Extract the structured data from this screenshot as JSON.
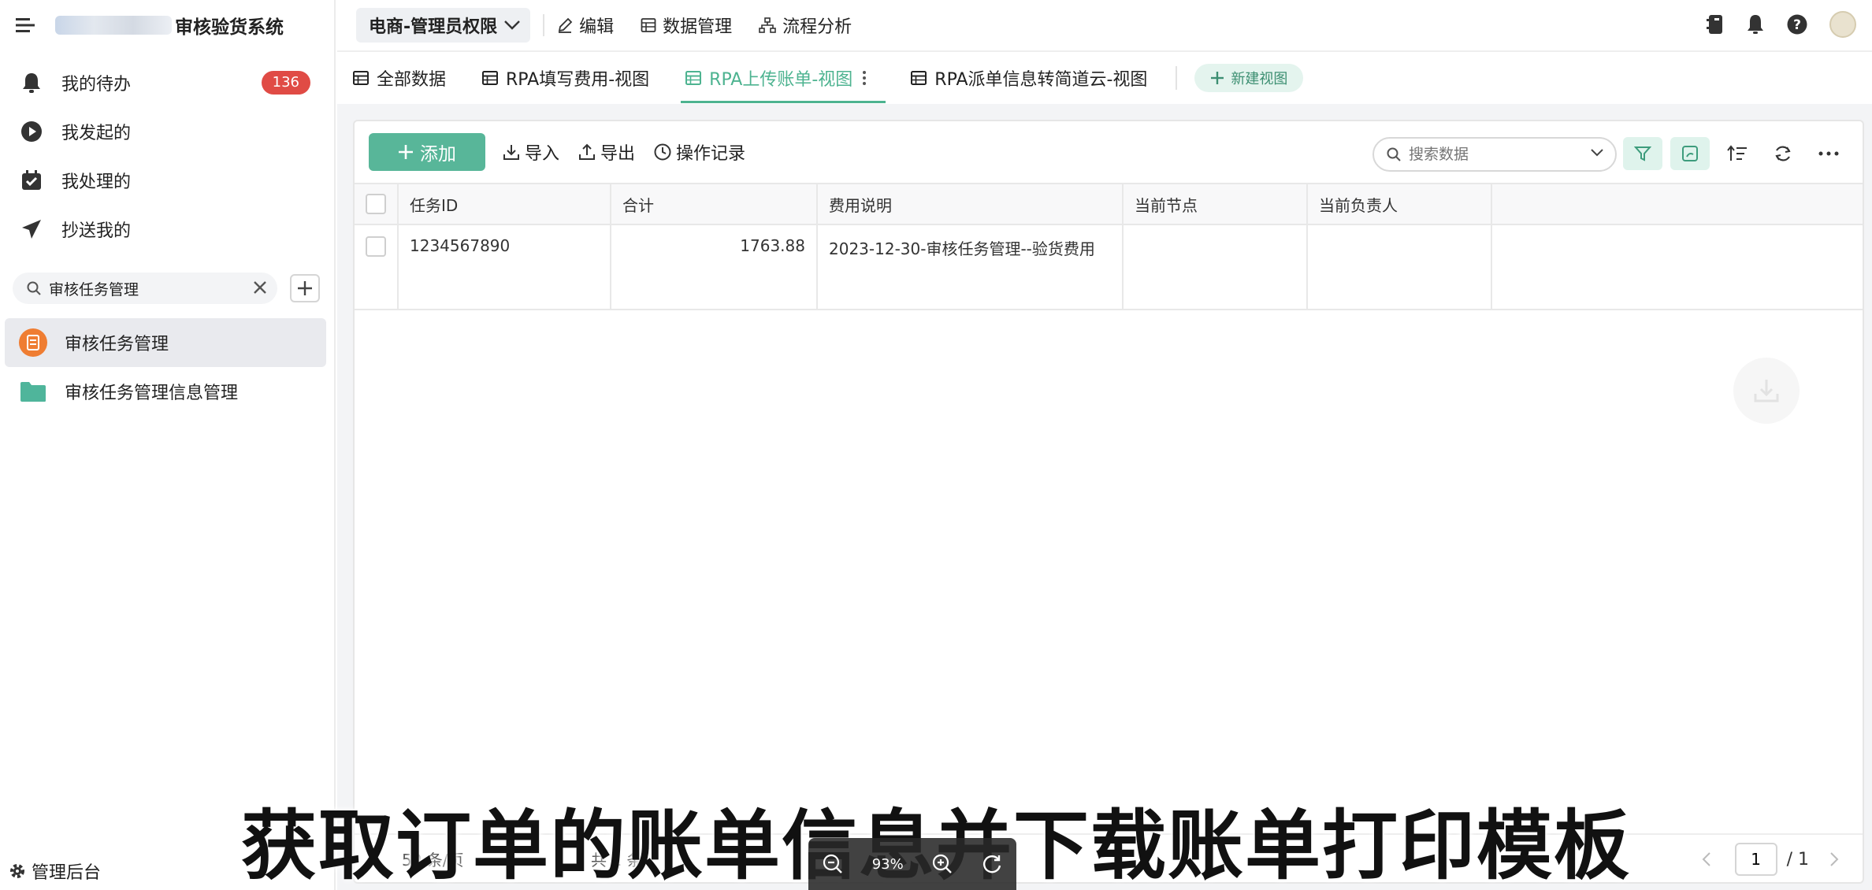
{
  "app": {
    "title": "审核验货系统"
  },
  "sidebar": {
    "nav": [
      {
        "label": "我的待办",
        "badge": "136"
      },
      {
        "label": "我发起的"
      },
      {
        "label": "我处理的"
      },
      {
        "label": "抄送我的"
      }
    ],
    "search": {
      "value": "审核任务管理",
      "placeholder": ""
    },
    "tree": [
      {
        "label": "审核任务管理",
        "active": true
      },
      {
        "label": "审核任务管理信息管理"
      }
    ],
    "admin_label": "管理后台"
  },
  "topbar": {
    "role": "电商-管理员权限",
    "links": [
      "编辑",
      "数据管理",
      "流程分析"
    ]
  },
  "tabs": {
    "items": [
      "全部数据",
      "RPA填写费用-视图",
      "RPA上传账单-视图",
      "RPA派单信息转简道云-视图"
    ],
    "active_index": 2,
    "new_view_label": "新建视图"
  },
  "toolbar": {
    "add_label": "添加",
    "import_label": "导入",
    "export_label": "导出",
    "log_label": "操作记录",
    "search_placeholder": "搜索数据"
  },
  "table": {
    "columns": [
      "任务ID",
      "合计",
      "费用说明",
      "当前节点",
      "当前负责人"
    ],
    "rows": [
      {
        "task_id": "1234567890",
        "total": "1763.88",
        "desc": "2023-12-30-审核任务管理--验货费用",
        "node": "",
        "owner": ""
      }
    ]
  },
  "footer": {
    "page_size": "50 条/页",
    "total": "共 1 条",
    "page": "1",
    "page_count": "/ 1"
  },
  "overlay": {
    "caption": "获取订单的账单信息并下载账单打印模板",
    "zoom": "93%"
  },
  "colors": {
    "accent": "#4db390",
    "button": "#58b699",
    "badge": "#e04b45"
  }
}
